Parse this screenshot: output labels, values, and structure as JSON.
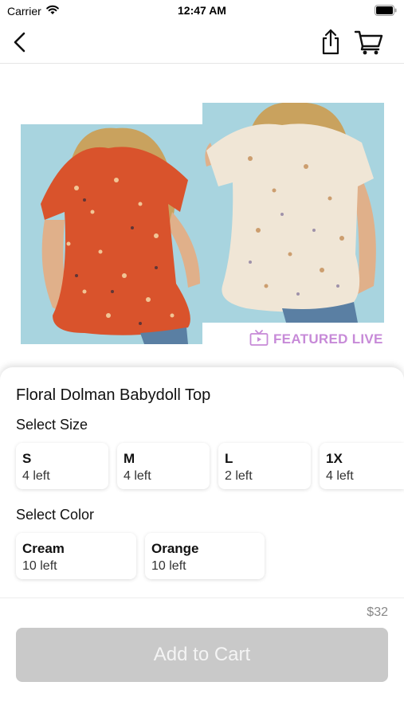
{
  "status_bar": {
    "carrier": "Carrier",
    "time": "12:47 AM",
    "wifi_icon": "wifi-icon",
    "battery_icon": "battery-icon"
  },
  "nav": {
    "back_icon": "chevron-left-icon",
    "share_icon": "share-icon",
    "cart_icon": "cart-icon"
  },
  "images": [
    {
      "name": "orange-floral-top-photo",
      "background": "#a8d4df",
      "garment_color": "#d9532c"
    },
    {
      "name": "cream-floral-top-photo",
      "background": "#a8d4df",
      "garment_color": "#f0e6d6"
    }
  ],
  "featured": {
    "label": "FEATURED LIVE",
    "icon": "tv-icon",
    "color": "#c78ad8"
  },
  "product": {
    "title": "Floral Dolman Babydoll Top",
    "size_label": "Select Size",
    "sizes": [
      {
        "name": "S",
        "stock": "4 left"
      },
      {
        "name": "M",
        "stock": "4 left"
      },
      {
        "name": "L",
        "stock": "2 left"
      },
      {
        "name": "1X",
        "stock": "4 left"
      }
    ],
    "color_label": "Select Color",
    "colors": [
      {
        "name": "Cream",
        "stock": "10 left"
      },
      {
        "name": "Orange",
        "stock": "10 left"
      }
    ]
  },
  "footer": {
    "price": "$32",
    "add_to_cart_label": "Add to Cart",
    "button_color": "#c9c9c9"
  }
}
